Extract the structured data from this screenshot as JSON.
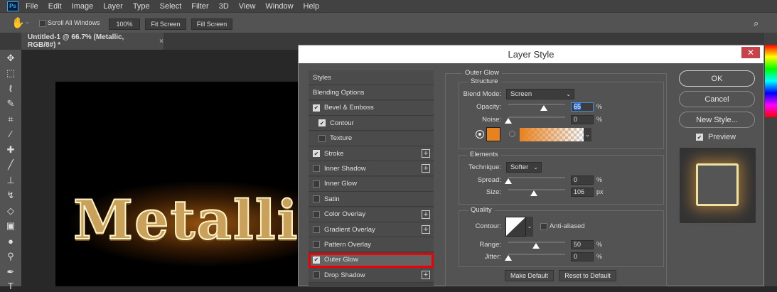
{
  "menubar": {
    "logo": "Ps",
    "items": [
      "File",
      "Edit",
      "Image",
      "Layer",
      "Type",
      "Select",
      "Filter",
      "3D",
      "View",
      "Window",
      "Help"
    ]
  },
  "options": {
    "scroll_all": "Scroll All Windows",
    "zoom100": "100%",
    "fit": "Fit Screen",
    "fill": "Fill Screen"
  },
  "document": {
    "tab_title": "Untitled-1 @ 66.7% (Metallic, RGB/8#) *",
    "close": "×",
    "canvas_text": "Metallic"
  },
  "dialog": {
    "title": "Layer Style",
    "close": "✕",
    "styles": [
      {
        "label": "Styles",
        "checkbox": null,
        "plus": false,
        "indent": false
      },
      {
        "label": "Blending Options",
        "checkbox": null,
        "plus": false,
        "indent": false
      },
      {
        "label": "Bevel & Emboss",
        "checkbox": true,
        "plus": false,
        "indent": false
      },
      {
        "label": "Contour",
        "checkbox": true,
        "plus": false,
        "indent": true
      },
      {
        "label": "Texture",
        "checkbox": false,
        "plus": false,
        "indent": true
      },
      {
        "label": "Stroke",
        "checkbox": true,
        "plus": true,
        "indent": false
      },
      {
        "label": "Inner Shadow",
        "checkbox": false,
        "plus": true,
        "indent": false
      },
      {
        "label": "Inner Glow",
        "checkbox": false,
        "plus": false,
        "indent": false
      },
      {
        "label": "Satin",
        "checkbox": false,
        "plus": false,
        "indent": false
      },
      {
        "label": "Color Overlay",
        "checkbox": false,
        "plus": true,
        "indent": false
      },
      {
        "label": "Gradient Overlay",
        "checkbox": false,
        "plus": true,
        "indent": false
      },
      {
        "label": "Pattern Overlay",
        "checkbox": false,
        "plus": false,
        "indent": false
      },
      {
        "label": "Outer Glow",
        "checkbox": true,
        "plus": false,
        "indent": false,
        "selected": true
      },
      {
        "label": "Drop Shadow",
        "checkbox": false,
        "plus": true,
        "indent": false
      }
    ],
    "outer_glow": {
      "title": "Outer Glow",
      "structure": {
        "title": "Structure",
        "blend_mode_label": "Blend Mode:",
        "blend_mode": "Screen",
        "opacity_label": "Opacity:",
        "opacity": "65",
        "noise_label": "Noise:",
        "noise": "0",
        "pct": "%",
        "color": "#e8821e"
      },
      "elements": {
        "title": "Elements",
        "technique_label": "Technique:",
        "technique": "Softer",
        "spread_label": "Spread:",
        "spread": "0",
        "size_label": "Size:",
        "size": "106",
        "px": "px"
      },
      "quality": {
        "title": "Quality",
        "contour_label": "Contour:",
        "anti_aliased": "Anti-aliased",
        "range_label": "Range:",
        "range": "50",
        "jitter_label": "Jitter:",
        "jitter": "0"
      },
      "make_default": "Make Default",
      "reset_default": "Reset to Default"
    },
    "ok": "OK",
    "cancel": "Cancel",
    "new_style": "New Style...",
    "preview": "Preview"
  }
}
